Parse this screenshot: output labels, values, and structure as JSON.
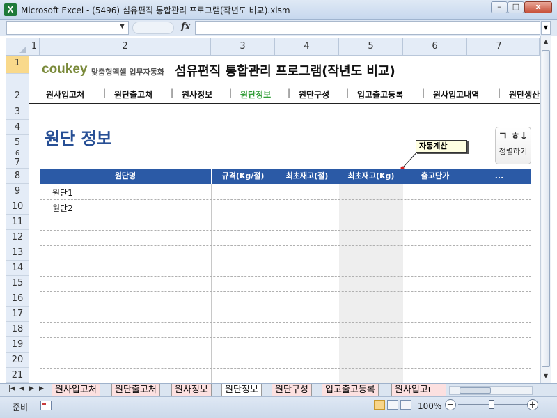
{
  "window": {
    "icon_letter": "X",
    "title": "Microsoft Excel - (5496) 섬유편직 통합관리 프로그램(작년도 비교).xlsm",
    "buttons": {
      "minimize": "–",
      "maximize": "□",
      "close": "x"
    }
  },
  "formula_bar": {
    "name_box_value": "",
    "fx_label": "fx",
    "formula_value": ""
  },
  "columns": [
    "1",
    "2",
    "3",
    "4",
    "5",
    "6",
    "7"
  ],
  "rows": [
    "1",
    "2",
    "3",
    "4",
    "5",
    "6",
    "7",
    "8",
    "9",
    "10",
    "11",
    "12",
    "13",
    "14",
    "15",
    "16",
    "17",
    "18",
    "19",
    "20",
    "21"
  ],
  "header": {
    "brand": "coukey",
    "brand_sub": "맞춤형엑셀 업무자동화",
    "app_title": "섬유편직 통합관리 프로그램(작년도 비교)"
  },
  "nav": {
    "items": [
      "원사입고처",
      "원단출고처",
      "원사정보",
      "원단정보",
      "원단구성",
      "입고출고등록",
      "원사입고내역",
      "원단생산"
    ],
    "active": "원단정보"
  },
  "page": {
    "heading": "원단 정보",
    "sort_button": {
      "icon": "ㄱ ㅎ↓",
      "label": "정렬하기"
    },
    "callout": "자동계산"
  },
  "table": {
    "headers": [
      "원단명",
      "규격(Kg/절)",
      "최초재고(절)",
      "최초재고(Kg)",
      "출고단가",
      "..."
    ],
    "rows": [
      {
        "name": "원단1"
      },
      {
        "name": "원단2"
      }
    ]
  },
  "sheet_tabs": {
    "tabs": [
      "원사입고처",
      "원단출고처",
      "원사정보",
      "원단정보",
      "원단구성",
      "입고출고등록",
      "원사입고ι"
    ],
    "active": "원단정보"
  },
  "status": {
    "ready": "준비",
    "zoom": "100%",
    "zoom_minus": "−",
    "zoom_plus": "+"
  },
  "colors": {
    "table_header": "#2b5aa6",
    "heading": "#274f95",
    "active_nav": "#2f9c35",
    "brand": "#7a8a3a",
    "tab_inactive": "#fce0e0"
  }
}
